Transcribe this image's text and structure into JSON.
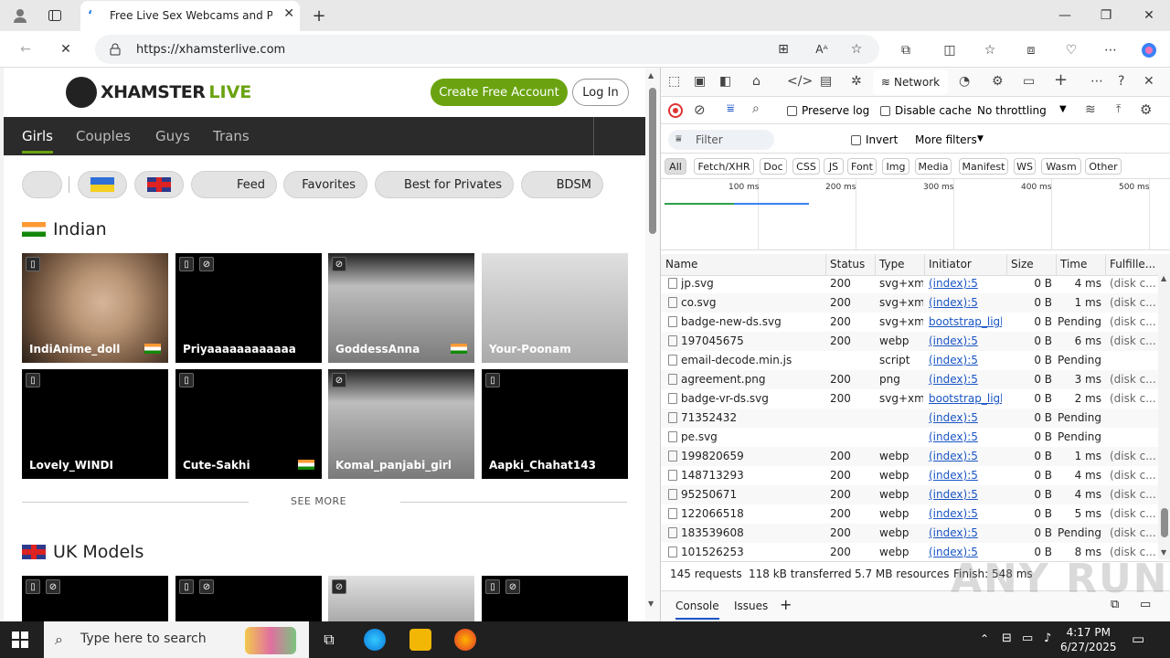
{
  "browser": {
    "tab_title": "Free Live Sex Webcams and Porn",
    "url": "https://xhamsterlive.com"
  },
  "site": {
    "logo_x": "XHAMSTER",
    "logo_live": "LIVE",
    "create_account": "Create Free Account",
    "login": "Log In",
    "categories": [
      "Girls",
      "Couples",
      "Guys",
      "Trans"
    ],
    "pills": [
      "Feed",
      "Favorites",
      "Best for Privates",
      "BDSM"
    ],
    "section_indian": "Indian",
    "section_uk": "UK Models",
    "see_more": "SEE MORE",
    "cards": [
      {
        "name": "IndiAnime_doll"
      },
      {
        "name": "Priyaaaaaaaaaaaa"
      },
      {
        "name": "GoddessAnna"
      },
      {
        "name": "Your-Poonam"
      },
      {
        "name": "Lovely_WINDI"
      },
      {
        "name": "Cute-Sakhi"
      },
      {
        "name": "Komal_panjabi_girl"
      },
      {
        "name": "Aapki_Chahat143"
      }
    ]
  },
  "devtools": {
    "network_tab": "Network",
    "preserve_log": "Preserve log",
    "disable_cache": "Disable cache",
    "throttling": "No throttling",
    "filter_placeholder": "Filter",
    "invert": "Invert",
    "more_filters": "More filters",
    "filter_types": [
      "All",
      "Fetch/XHR",
      "Doc",
      "CSS",
      "JS",
      "Font",
      "Img",
      "Media",
      "Manifest",
      "WS",
      "Wasm",
      "Other"
    ],
    "timeline_ticks": [
      "100 ms",
      "200 ms",
      "300 ms",
      "400 ms",
      "500 ms"
    ],
    "columns": [
      "Name",
      "Status",
      "Type",
      "Initiator",
      "Size",
      "Time",
      "Fulfille..."
    ],
    "rows": [
      {
        "name": "jp.svg",
        "status": "200",
        "type": "svg+xml",
        "initiator": "(index):5",
        "size": "0 B",
        "time": "4 ms",
        "fulfilled": "(disk c..."
      },
      {
        "name": "co.svg",
        "status": "200",
        "type": "svg+xml",
        "initiator": "(index):5",
        "size": "0 B",
        "time": "1 ms",
        "fulfilled": "(disk c..."
      },
      {
        "name": "badge-new-ds.svg",
        "status": "200",
        "type": "svg+xml",
        "initiator": "bootstrap_light.c",
        "size": "0 B",
        "time": "Pending",
        "fulfilled": "(disk c..."
      },
      {
        "name": "197045675",
        "status": "200",
        "type": "webp",
        "initiator": "(index):5",
        "size": "0 B",
        "time": "6 ms",
        "fulfilled": "(disk c..."
      },
      {
        "name": "email-decode.min.js",
        "status": "",
        "type": "script",
        "initiator": "(index):5",
        "size": "0 B",
        "time": "Pending",
        "fulfilled": ""
      },
      {
        "name": "agreement.png",
        "status": "200",
        "type": "png",
        "initiator": "(index):5",
        "size": "0 B",
        "time": "3 ms",
        "fulfilled": "(disk c..."
      },
      {
        "name": "badge-vr-ds.svg",
        "status": "200",
        "type": "svg+xml",
        "initiator": "bootstrap_light.c",
        "size": "0 B",
        "time": "2 ms",
        "fulfilled": "(disk c..."
      },
      {
        "name": "71352432",
        "status": "",
        "type": "",
        "initiator": "(index):5",
        "size": "0 B",
        "time": "Pending",
        "fulfilled": ""
      },
      {
        "name": "pe.svg",
        "status": "",
        "type": "",
        "initiator": "(index):5",
        "size": "0 B",
        "time": "Pending",
        "fulfilled": ""
      },
      {
        "name": "199820659",
        "status": "200",
        "type": "webp",
        "initiator": "(index):5",
        "size": "0 B",
        "time": "1 ms",
        "fulfilled": "(disk c..."
      },
      {
        "name": "148713293",
        "status": "200",
        "type": "webp",
        "initiator": "(index):5",
        "size": "0 B",
        "time": "4 ms",
        "fulfilled": "(disk c..."
      },
      {
        "name": "95250671",
        "status": "200",
        "type": "webp",
        "initiator": "(index):5",
        "size": "0 B",
        "time": "4 ms",
        "fulfilled": "(disk c..."
      },
      {
        "name": "122066518",
        "status": "200",
        "type": "webp",
        "initiator": "(index):5",
        "size": "0 B",
        "time": "5 ms",
        "fulfilled": "(disk c..."
      },
      {
        "name": "183539608",
        "status": "200",
        "type": "webp",
        "initiator": "(index):5",
        "size": "0 B",
        "time": "Pending",
        "fulfilled": "(disk c..."
      },
      {
        "name": "101526253",
        "status": "200",
        "type": "webp",
        "initiator": "(index):5",
        "size": "0 B",
        "time": "8 ms",
        "fulfilled": "(disk c..."
      }
    ],
    "status_requests": "145 requests",
    "status_transferred": "118 kB transferred",
    "status_resources": "5.7 MB resources",
    "status_finish": "Finish: 548 ms",
    "drawer_console": "Console",
    "drawer_issues": "Issues"
  },
  "taskbar": {
    "search_placeholder": "Type here to search",
    "time": "4:17 PM",
    "date": "6/27/2025"
  },
  "watermark": "ANY RUN"
}
